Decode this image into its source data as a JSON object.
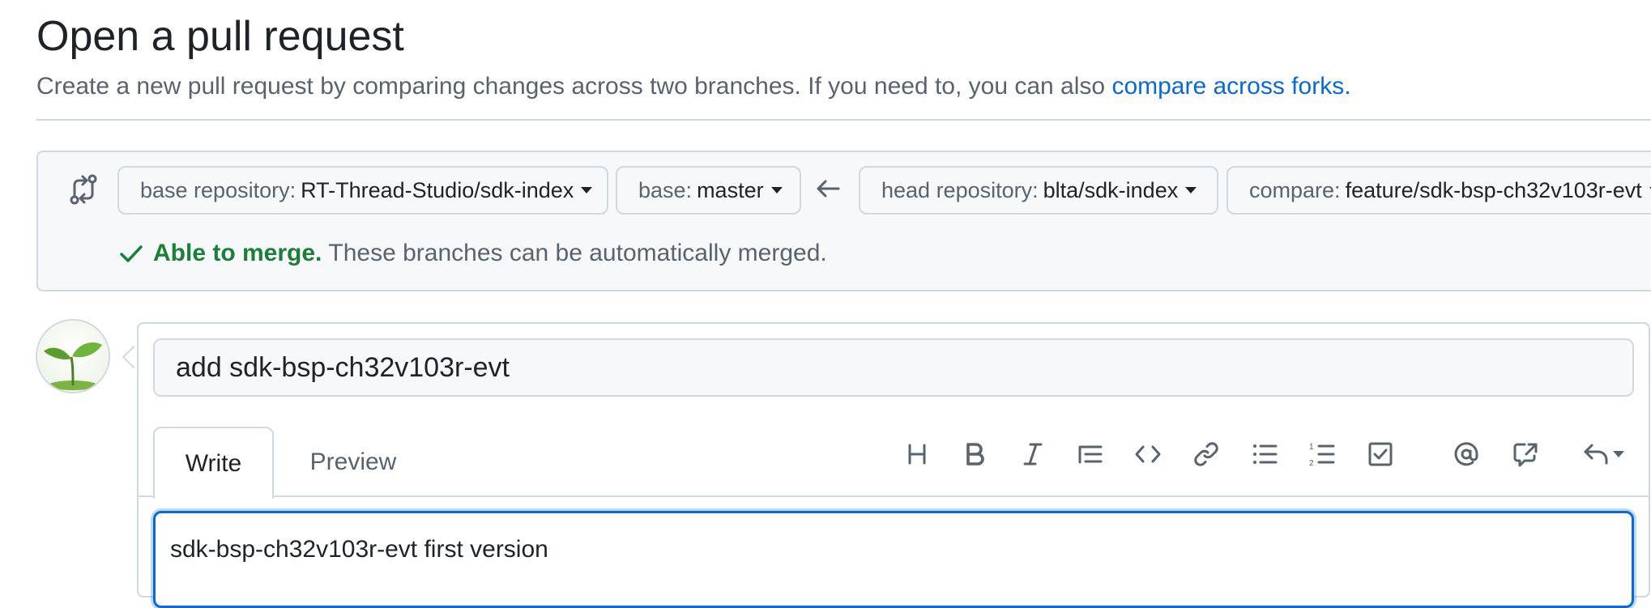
{
  "header": {
    "title": "Open a pull request",
    "subhead_text": "Create a new pull request by comparing changes across two branches. If you need to, you can also ",
    "subhead_link": "compare across forks."
  },
  "range": {
    "base_repo": {
      "label": "base repository:",
      "value": "RT-Thread-Studio/sdk-index"
    },
    "base_branch": {
      "label": "base:",
      "value": "master"
    },
    "head_repo": {
      "label": "head repository:",
      "value": "blta/sdk-index"
    },
    "compare_branch": {
      "label": "compare:",
      "value": "feature/sdk-bsp-ch32v103r-evt"
    },
    "merge_status": {
      "bold": "Able to merge.",
      "text": "These branches can be automatically merged."
    }
  },
  "form": {
    "title_value": "add sdk-bsp-ch32v103r-evt",
    "tabs": {
      "write": "Write",
      "preview": "Preview"
    },
    "body_value": "sdk-bsp-ch32v103r-evt first version",
    "toolbar_icons": [
      "heading-icon",
      "bold-icon",
      "italic-icon",
      "quote-icon",
      "code-icon",
      "link-icon",
      "unordered-list-icon",
      "ordered-list-icon",
      "task-list-icon",
      "mention-icon",
      "cross-reference-icon",
      "reply-icon"
    ]
  },
  "colors": {
    "link": "#0969da",
    "success": "#1a7f37",
    "focus": "#0969da"
  }
}
